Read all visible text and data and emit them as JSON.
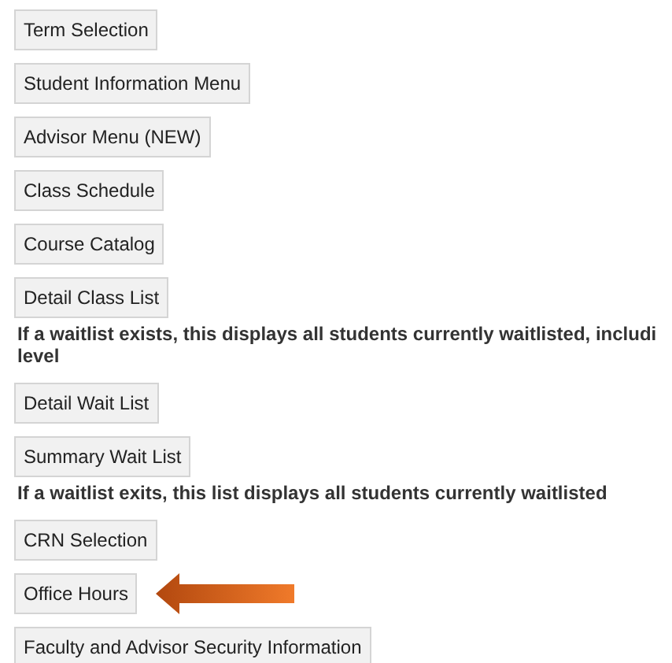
{
  "items": [
    {
      "kind": "button",
      "label": "Term Selection",
      "highlighted": false
    },
    {
      "kind": "button",
      "label": "Student Information Menu",
      "highlighted": false
    },
    {
      "kind": "button",
      "label": "Advisor Menu (NEW)",
      "highlighted": false
    },
    {
      "kind": "button",
      "label": "Class Schedule",
      "highlighted": false
    },
    {
      "kind": "button",
      "label": "Course Catalog",
      "highlighted": false
    },
    {
      "kind": "button",
      "label": "Detail Class List",
      "highlighted": false
    },
    {
      "kind": "note",
      "text": "If a waitlist exists, this displays all students currently waitlisted, includi\nlevel"
    },
    {
      "kind": "button",
      "label": "Detail Wait List",
      "highlighted": false
    },
    {
      "kind": "button",
      "label": "Summary Wait List",
      "highlighted": false
    },
    {
      "kind": "note",
      "text": "If a waitlist exits, this list displays all students currently waitlisted"
    },
    {
      "kind": "button",
      "label": "CRN Selection",
      "highlighted": false
    },
    {
      "kind": "button",
      "label": "Office Hours",
      "highlighted": true
    },
    {
      "kind": "button",
      "label": "Faculty and Advisor Security Information",
      "highlighted": false
    }
  ]
}
